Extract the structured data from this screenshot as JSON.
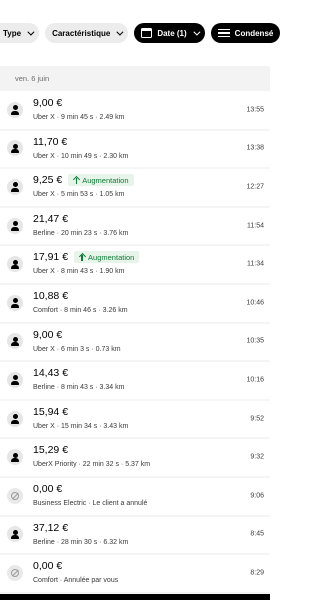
{
  "filters": {
    "type_label": "Type",
    "feature_label": "Caractéristique",
    "date_label": "Date (1)",
    "condensed_label": "Condensé"
  },
  "date_header": "ven. 6 juin",
  "trips": [
    {
      "amount": "9,00 €",
      "detail": "Uber X · 9 min 45 s · 2.49 km",
      "time": "13:55",
      "badge": "",
      "cancelled": false
    },
    {
      "amount": "11,70 €",
      "detail": "Uber X · 10 min 49 s · 2.30 km",
      "time": "13:38",
      "badge": "",
      "cancelled": false
    },
    {
      "amount": "9,25 €",
      "detail": "Uber X · 5 min 53 s · 1.05 km",
      "time": "12:27",
      "badge": "Augmentation",
      "cancelled": false
    },
    {
      "amount": "21,47 €",
      "detail": "Berline · 20 min 23 s · 3.76 km",
      "time": "11:54",
      "badge": "",
      "cancelled": false
    },
    {
      "amount": "17,91 €",
      "detail": "Uber X · 8 min 43 s · 1.90 km",
      "time": "11:34",
      "badge": "Augmentation",
      "cancelled": false
    },
    {
      "amount": "10,88 €",
      "detail": "Comfort · 8 min 46 s · 3.26 km",
      "time": "10:46",
      "badge": "",
      "cancelled": false
    },
    {
      "amount": "9,00 €",
      "detail": "Uber X · 6 min 3 s · 0.73 km",
      "time": "10:35",
      "badge": "",
      "cancelled": false
    },
    {
      "amount": "14,43 €",
      "detail": "Berline · 8 min 43 s · 3.34 km",
      "time": "10:16",
      "badge": "",
      "cancelled": false
    },
    {
      "amount": "15,94 €",
      "detail": "Uber X · 15 min 34 s · 3.43 km",
      "time": "9:52",
      "badge": "",
      "cancelled": false
    },
    {
      "amount": "15,29 €",
      "detail": "UberX Priority · 22 min 32 s · 5.37 km",
      "time": "9:32",
      "badge": "",
      "cancelled": false
    },
    {
      "amount": "0,00 €",
      "detail": "Business Electric · Le client a annulé",
      "time": "9:06",
      "badge": "",
      "cancelled": true
    },
    {
      "amount": "37,12 €",
      "detail": "Berline · 28 min 30 s · 6.32 km",
      "time": "8:45",
      "badge": "",
      "cancelled": false
    },
    {
      "amount": "0,00 €",
      "detail": "Comfort · Annulée par vous",
      "time": "8:29",
      "badge": "",
      "cancelled": true
    }
  ],
  "colors": {
    "badge_bg": "#e7f4ea",
    "badge_text": "#0e7a36",
    "chip_dark": "#000000",
    "chip_light": "#ececec"
  }
}
